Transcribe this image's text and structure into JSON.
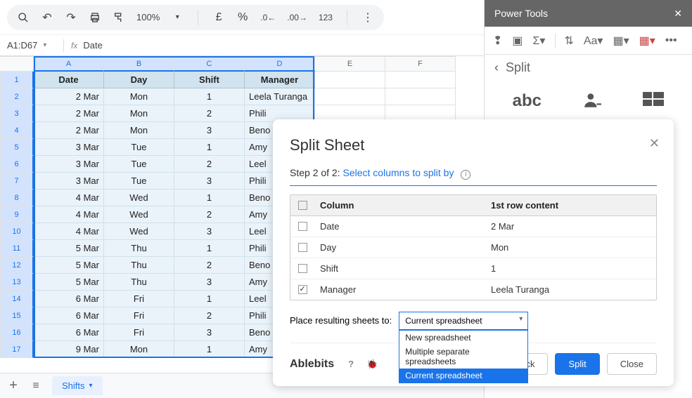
{
  "toolbar": {
    "zoom": "100%",
    "currency": "£",
    "percent": "%",
    "numfmt": "123"
  },
  "namebox": "A1:D67",
  "formula_value": "Date",
  "columns": [
    "A",
    "B",
    "C",
    "D",
    "E",
    "F"
  ],
  "headers": [
    "Date",
    "Day",
    "Shift",
    "Manager"
  ],
  "rows": [
    {
      "n": 1,
      "date": "",
      "day": "",
      "shift": "",
      "mgr": ""
    },
    {
      "n": 2,
      "date": "2 Mar",
      "day": "Mon",
      "shift": "1",
      "mgr": "Leela Turanga"
    },
    {
      "n": 3,
      "date": "2 Mar",
      "day": "Mon",
      "shift": "2",
      "mgr": "Phili"
    },
    {
      "n": 4,
      "date": "2 Mar",
      "day": "Mon",
      "shift": "3",
      "mgr": "Beno"
    },
    {
      "n": 5,
      "date": "3 Mar",
      "day": "Tue",
      "shift": "1",
      "mgr": "Amy"
    },
    {
      "n": 6,
      "date": "3 Mar",
      "day": "Tue",
      "shift": "2",
      "mgr": "Leel"
    },
    {
      "n": 7,
      "date": "3 Mar",
      "day": "Tue",
      "shift": "3",
      "mgr": "Phili"
    },
    {
      "n": 8,
      "date": "4 Mar",
      "day": "Wed",
      "shift": "1",
      "mgr": "Beno"
    },
    {
      "n": 9,
      "date": "4 Mar",
      "day": "Wed",
      "shift": "2",
      "mgr": "Amy"
    },
    {
      "n": 10,
      "date": "4 Mar",
      "day": "Wed",
      "shift": "3",
      "mgr": "Leel"
    },
    {
      "n": 11,
      "date": "5 Mar",
      "day": "Thu",
      "shift": "1",
      "mgr": "Phili"
    },
    {
      "n": 12,
      "date": "5 Mar",
      "day": "Thu",
      "shift": "2",
      "mgr": "Beno"
    },
    {
      "n": 13,
      "date": "5 Mar",
      "day": "Thu",
      "shift": "3",
      "mgr": "Amy"
    },
    {
      "n": 14,
      "date": "6 Mar",
      "day": "Fri",
      "shift": "1",
      "mgr": "Leel"
    },
    {
      "n": 15,
      "date": "6 Mar",
      "day": "Fri",
      "shift": "2",
      "mgr": "Phili"
    },
    {
      "n": 16,
      "date": "6 Mar",
      "day": "Fri",
      "shift": "3",
      "mgr": "Beno"
    },
    {
      "n": 17,
      "date": "9 Mar",
      "day": "Mon",
      "shift": "1",
      "mgr": "Amy"
    }
  ],
  "sheet_tab": "Shifts",
  "sidepanel": {
    "title": "Power Tools",
    "back_label": "Split",
    "feature_icons": [
      "abc",
      "person",
      "grid"
    ]
  },
  "dialog": {
    "title": "Split Sheet",
    "step_prefix": "Step 2 of 2: ",
    "step_link": "Select columns to split by",
    "th1": "Column",
    "th2": "1st row content",
    "cols": [
      {
        "name": "Date",
        "sample": "2 Mar",
        "checked": false
      },
      {
        "name": "Day",
        "sample": "Mon",
        "checked": false
      },
      {
        "name": "Shift",
        "sample": "1",
        "checked": false
      },
      {
        "name": "Manager",
        "sample": "Leela Turanga",
        "checked": true
      }
    ],
    "place_label": "Place resulting sheets to:",
    "dropdown_value": "Current spreadsheet",
    "dd_options": [
      "New spreadsheet",
      "Multiple separate spreadsheets",
      "Current spreadsheet"
    ],
    "logo": "Ablebits",
    "btn_back": "< Back",
    "btn_split": "Split",
    "btn_close": "Close"
  }
}
